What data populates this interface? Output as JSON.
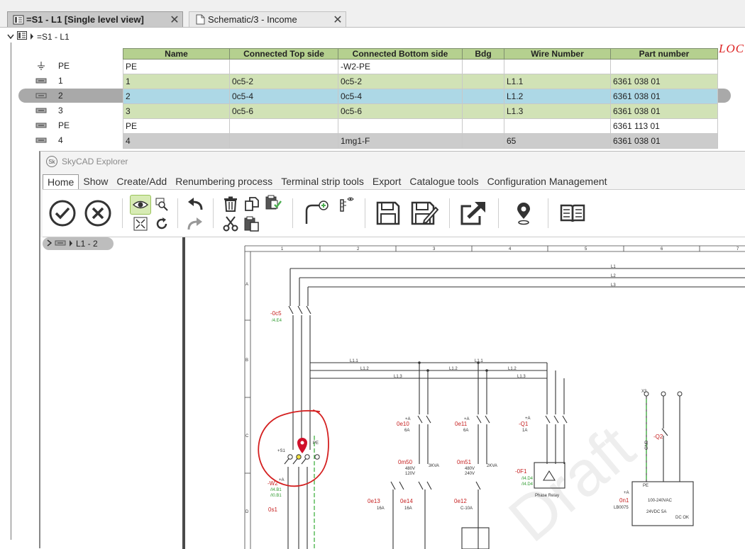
{
  "tabs": [
    {
      "label": "=S1 - L1 [Single level view]",
      "close": "✕",
      "icon": "frame-icon"
    },
    {
      "label": "Schematic/3 - Income",
      "close": "✕",
      "icon": "page-icon"
    }
  ],
  "tree": {
    "root_label": "=S1 - L1",
    "rows": [
      {
        "label": "PE",
        "icon": "ground-icon"
      },
      {
        "label": "1",
        "icon": "terminal-icon"
      },
      {
        "label": "2",
        "icon": "terminal-icon"
      },
      {
        "label": "3",
        "icon": "terminal-icon"
      },
      {
        "label": "PE",
        "icon": "terminal-icon"
      },
      {
        "label": "4",
        "icon": "terminal-icon"
      }
    ]
  },
  "table": {
    "columns": [
      "Name",
      "Connected Top side",
      "Connected Bottom side",
      "Bdg",
      "Wire Number",
      "Part number"
    ],
    "rows": [
      [
        "PE",
        "",
        "-W2-PE",
        "",
        "",
        ""
      ],
      [
        "1",
        "0c5-2",
        "0c5-2",
        "",
        "L1.1",
        "6361 038 01"
      ],
      [
        "2",
        "0c5-4",
        "0c5-4",
        "",
        "L1.2",
        "6361 038 01"
      ],
      [
        "3",
        "0c5-6",
        "0c5-6",
        "",
        "L1.3",
        "6361 038 01"
      ],
      [
        "PE",
        "",
        "",
        "",
        "",
        "6361 113 01"
      ],
      [
        "4",
        "",
        "1mg1-F",
        "",
        "65",
        "6361 038 01"
      ]
    ],
    "selected_row": 2,
    "header_color": "#b5d08f",
    "selection_color": "#add8e6"
  },
  "annotation": {
    "loc_text": "LOC",
    "color": "#d22222"
  },
  "explorer": {
    "title": "SkyCAD Explorer",
    "logo": "Sk",
    "menu": [
      "Home",
      "Show",
      "Create/Add",
      "Renumbering process",
      "Terminal strip tools",
      "Export",
      "Catalogue tools",
      "Configuration Management"
    ],
    "active_menu": "Home",
    "toolbar_icons": [
      "confirm-icon",
      "cancel-icon",
      "view-icon",
      "zoom-icon",
      "fit-icon",
      "undo-icon",
      "redo-icon",
      "refresh-icon",
      "delete-icon",
      "copy-icon",
      "cut-icon",
      "paste-icon",
      "paste-special-icon",
      "add-connection-icon",
      "terminal-view-icon",
      "save-icon",
      "save-as-icon",
      "export-icon",
      "location-icon",
      "book-icon"
    ],
    "tree_node": "L1 - 2"
  },
  "schematic": {
    "columns": [
      "1",
      "2",
      "3",
      "4",
      "5",
      "6",
      "7"
    ],
    "rows": [
      "A",
      "B",
      "C",
      "D"
    ],
    "bus_lines": [
      "L1",
      "L2",
      "L3"
    ],
    "wire_labels": [
      "L1.1",
      "L1.2",
      "L1.3"
    ],
    "components": {
      "qs": "-0c5",
      "qs_ref": "/4.E4",
      "term_x": "+S1",
      "term_label": "-W2",
      "terminal_refs": [
        "/I4.B1",
        "/I0.B1"
      ],
      "os": "0s1",
      "e10": "0e10",
      "e10_r": "6A",
      "e11": "0e11",
      "e11_r": "6A",
      "m50": "0m50",
      "m50_r": "3KVA",
      "m50_v": [
        "480V",
        "120V"
      ],
      "m51": "0m51",
      "m51_r": "2KVA",
      "m51_v": [
        "480V",
        "240V"
      ],
      "e13": "0e13",
      "e13_r": "16A",
      "e14": "0e14",
      "e14_r": "16A",
      "e12": "0e12",
      "e12_r": "C-10A",
      "q1": "-Q1",
      "q1_r": "1A",
      "f1": "-0F1",
      "f1_refs": [
        "/I4.D4",
        "/I4.D4"
      ],
      "phase_relay": "Phase Relay",
      "x3": "X3",
      "q2": "-Q2",
      "psu": "100-240VAC",
      "psu_out": "24VDC 5A",
      "psu_ok": "DC OK",
      "psu_tag": "0n1",
      "psu_sub": "LB0075",
      "plus_a": "+A",
      "gnd": "GND",
      "pe": "PE"
    },
    "watermark": "Draft",
    "marker_color": "#d0102a"
  }
}
